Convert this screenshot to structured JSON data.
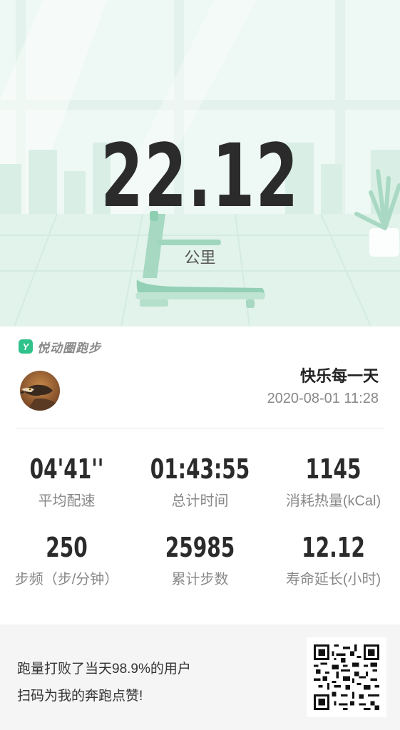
{
  "hero": {
    "distance": "22.12",
    "unit": "公里"
  },
  "brand": {
    "logo_letter": "Y",
    "name": "悦动圈跑步"
  },
  "user": {
    "name": "快乐每一天",
    "datetime": "2020-08-01 11:28"
  },
  "stats": [
    {
      "value": "04'41''",
      "label": "平均配速"
    },
    {
      "value": "01:43:55",
      "label": "总计时间"
    },
    {
      "value": "1145",
      "label": "消耗热量(kCal)"
    },
    {
      "value": "250",
      "label": "步频（步/分钟）"
    },
    {
      "value": "25985",
      "label": "累计步数"
    },
    {
      "value": "12.12",
      "label": "寿命延长(小时)"
    }
  ],
  "footer": {
    "line1": "跑量打败了当天98.9%的用户",
    "line2": "扫码为我的奔跑点赞!"
  },
  "colors": {
    "accent": "#2fc28b",
    "hero_bg": "#e8f5ef",
    "text_dark": "#2b2b2b",
    "text_muted": "#888888",
    "footer_bg": "#f5f5f5"
  },
  "icons": {
    "brand": "yuedong-logo-icon",
    "avatar": "eagle-avatar",
    "qr": "qr-code-icon"
  }
}
